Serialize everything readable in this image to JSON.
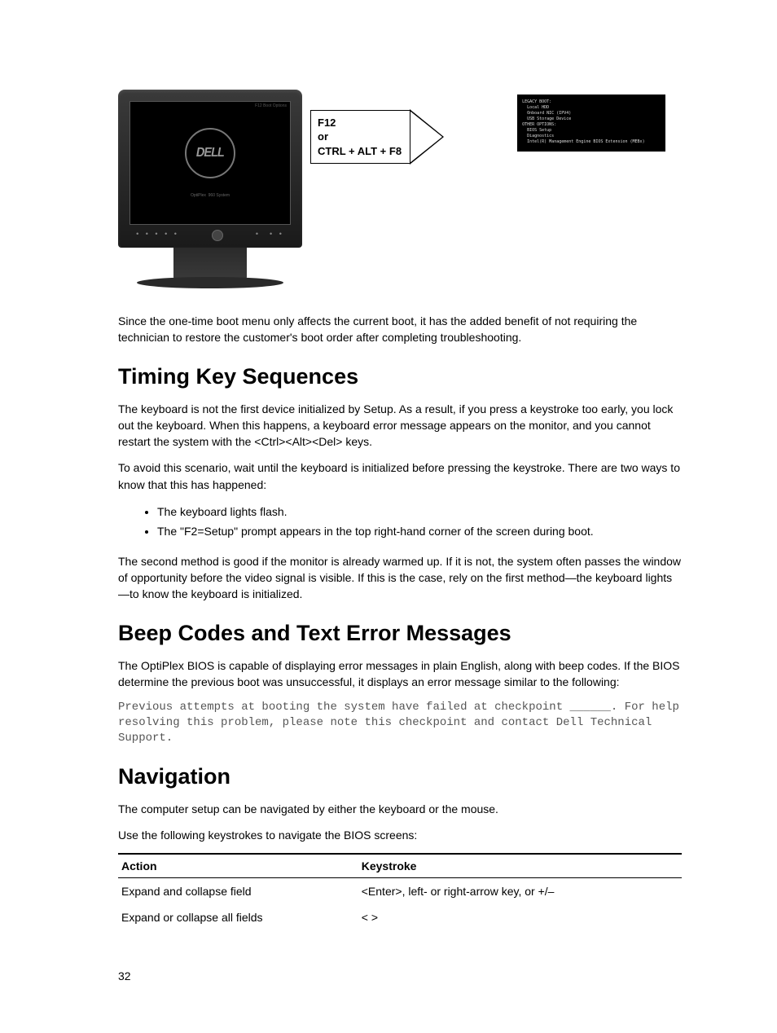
{
  "figure": {
    "arrow_line1": "F12",
    "arrow_line2": "or",
    "arrow_line3": "CTRL + ALT + F8",
    "dell": "DELL",
    "bios_text": "LEGACY BOOT:\n  Local HDD\n  Onboard NIC (IPV4)\n  USB Storage Device\nOTHER OPTIONS:\n  BIOS Setup\n  Diagnostics\n  Intel(R) Management Engine BIOS Extension (MEBx)"
  },
  "intro_para": "Since the one-time boot menu only affects the current boot, it has the added benefit of not requiring the technician to restore the customer's boot order after completing troubleshooting.",
  "timing": {
    "heading": "Timing Key Sequences",
    "p1": "The keyboard is not the first device initialized by Setup. As a result, if you press a keystroke too early, you lock out the keyboard. When this happens, a keyboard error message appears on the monitor, and you cannot restart the system with the <Ctrl><Alt><Del> keys.",
    "p2": "To avoid this scenario, wait until the keyboard is initialized before pressing the keystroke. There are two ways to know that this has happened:",
    "b1": "The keyboard lights flash.",
    "b2": "The \"F2=Setup\" prompt appears in the top right-hand corner of the screen during boot.",
    "p3": "The second method is good if the monitor is already warmed up. If it is not, the system often passes the window of opportunity before the video signal is visible. If this is the case, rely on the first method—the keyboard lights—to know the keyboard is initialized."
  },
  "beep": {
    "heading": "Beep Codes and Text Error Messages",
    "p1": "The OptiPlex BIOS is capable of displaying error messages in plain English, along with beep codes. If the BIOS determine the previous boot was unsuccessful, it displays an error message similar to the following:",
    "code": "Previous attempts at booting the system have failed at checkpoint ______. For help resolving this problem, please note this checkpoint and contact Dell Technical Support."
  },
  "nav": {
    "heading": "Navigation",
    "p1": "The computer setup can be navigated by either the keyboard or the mouse.",
    "p2": "Use the following keystrokes to navigate the BIOS screens:",
    "th1": "Action",
    "th2": "Keystroke",
    "rows": [
      {
        "action": "Expand and collapse field",
        "key": "<Enter>, left- or right-arrow key, or +/–"
      },
      {
        "action": "Expand or collapse all fields",
        "key": "< >"
      }
    ]
  },
  "page_number": "32"
}
